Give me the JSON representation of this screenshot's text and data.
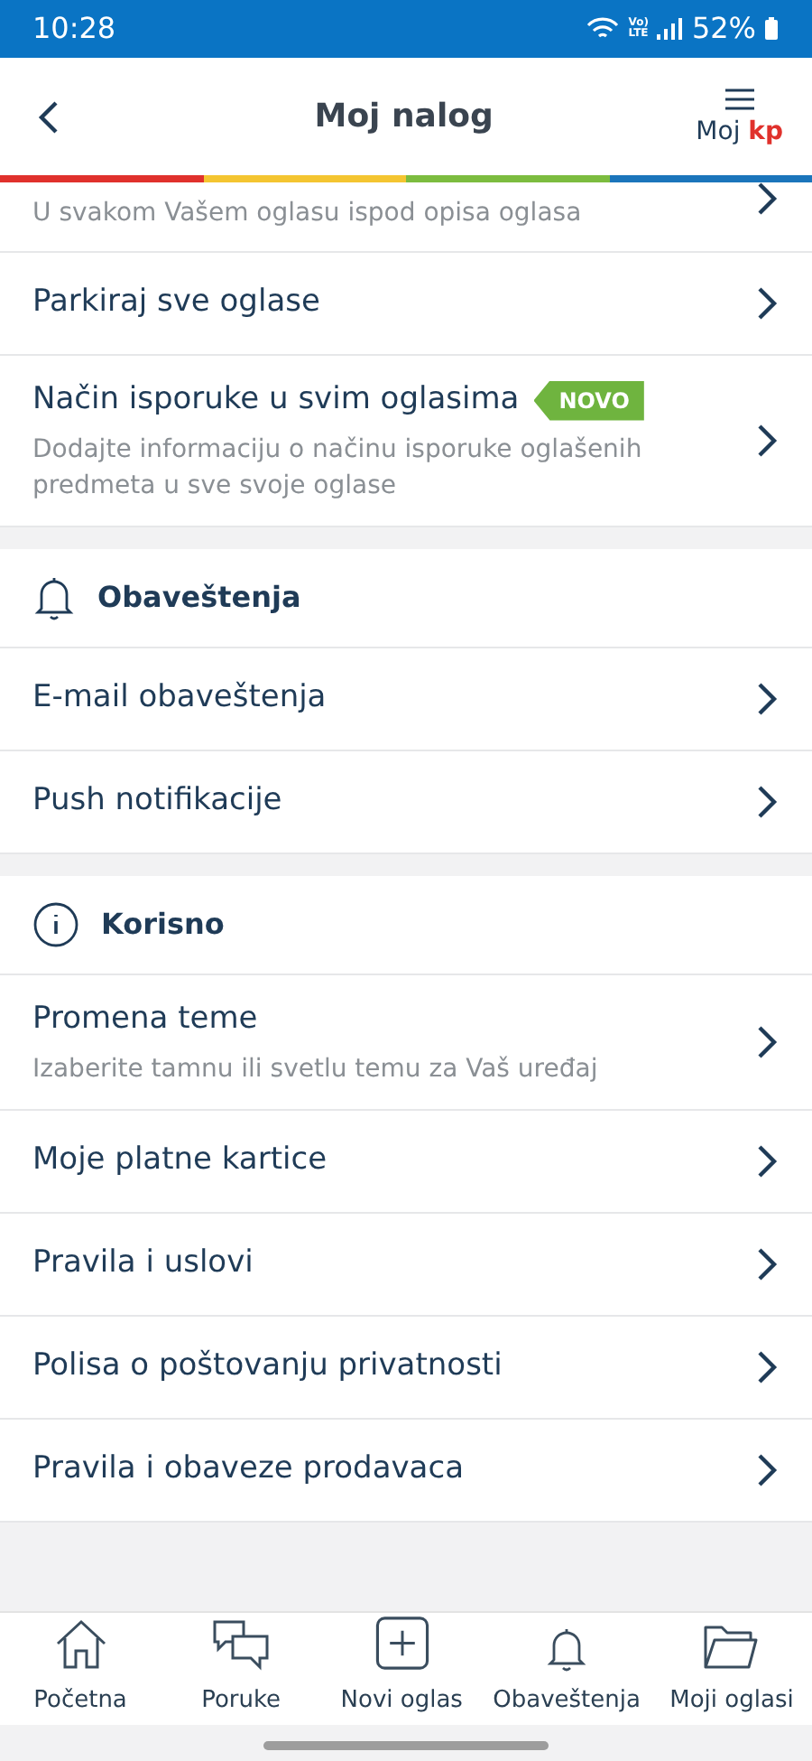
{
  "status_bar": {
    "time": "10:28",
    "volte": [
      "Vo)",
      "LTE"
    ],
    "battery": "52%"
  },
  "header": {
    "title": "Moj nalog",
    "menu_label": "Moj",
    "menu_brand": "kp"
  },
  "sections": [
    {
      "items": [
        {
          "subtitle": "U svakom Vašem oglasu ispod opisa oglasa"
        },
        {
          "title": "Parkiraj sve oglase"
        },
        {
          "title": "Način isporuke u svim oglasima",
          "badge": "NOVO",
          "subtitle": "Dodajte informaciju o načinu isporuke oglašenih predmeta u sve svoje oglase"
        }
      ]
    },
    {
      "title": "Obaveštenja",
      "items": [
        {
          "title": "E-mail obaveštenja"
        },
        {
          "title": "Push notifikacije"
        }
      ]
    },
    {
      "title": "Korisno",
      "items": [
        {
          "title": "Promena teme",
          "subtitle": "Izaberite tamnu ili svetlu temu za Vaš uređaj"
        },
        {
          "title": "Moje platne kartice"
        },
        {
          "title": "Pravila i uslovi"
        },
        {
          "title": "Polisa o poštovanju privatnosti"
        },
        {
          "title": "Pravila i obaveze prodavaca"
        }
      ]
    }
  ],
  "bottom_nav": [
    {
      "label": "Početna"
    },
    {
      "label": "Poruke"
    },
    {
      "label": "Novi oglas"
    },
    {
      "label": "Obaveštenja"
    },
    {
      "label": "Moji oglasi"
    }
  ]
}
